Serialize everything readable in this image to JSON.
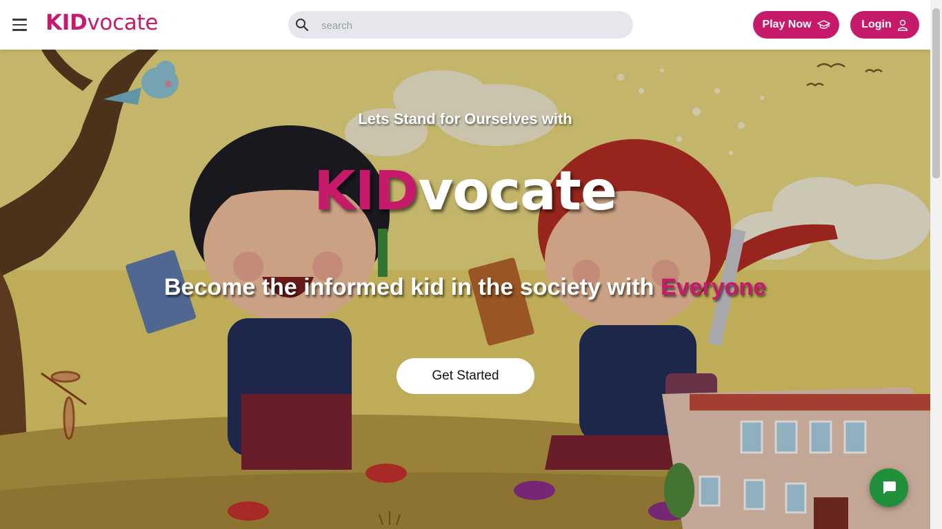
{
  "theme": {
    "brand_pink": "#c51b6a",
    "chat_green": "#1f8f3a"
  },
  "header": {
    "menu_icon": "hamburger-menu-icon",
    "brand_kid": "KID",
    "brand_vocate": "vocate",
    "search_placeholder": "search",
    "search_icon": "search-icon",
    "play_now_label": "Play Now",
    "play_now_icon": "graduation-cap-icon",
    "login_label": "Login",
    "login_icon": "user-icon"
  },
  "hero": {
    "tagline": "Lets Stand for Ourselves with",
    "brand_kid": "KID",
    "brand_vocate": "vocate",
    "subline_prefix": "Become the informed kid in the society with ",
    "subline_highlight": "Everyone",
    "cta_label": "Get Started"
  },
  "chat": {
    "icon": "chat-bubble-icon"
  }
}
